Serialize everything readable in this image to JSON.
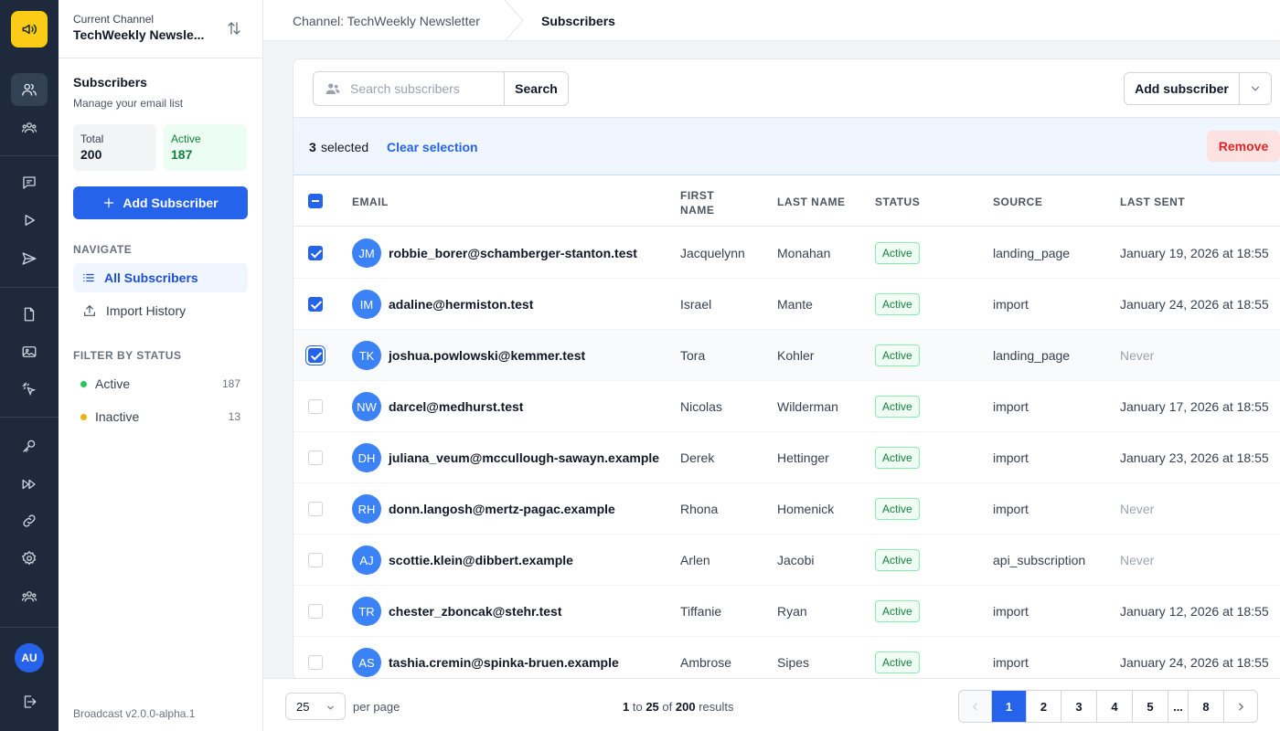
{
  "sidebar": {
    "channel_label": "Current Channel",
    "channel_name": "TechWeekly Newsle...",
    "section_title": "Subscribers",
    "section_subtitle": "Manage your email list",
    "stats": {
      "total_label": "Total",
      "total_value": "200",
      "active_label": "Active",
      "active_value": "187"
    },
    "add_button": "Add Subscriber",
    "navigate_heading": "NAVIGATE",
    "nav_items": [
      {
        "label": "All Subscribers"
      },
      {
        "label": "Import History"
      }
    ],
    "filter_heading": "FILTER BY STATUS",
    "filters": [
      {
        "label": "Active",
        "count": "187",
        "color": "#22c55e"
      },
      {
        "label": "Inactive",
        "count": "13",
        "color": "#eab308"
      }
    ],
    "version": "Broadcast v2.0.0-alpha.1"
  },
  "rail": {
    "avatar_initials": "AU"
  },
  "breadcrumb": {
    "channel": "Channel: TechWeekly Newsletter",
    "current": "Subscribers"
  },
  "toolbar": {
    "search_placeholder": "Search subscribers",
    "search_button": "Search",
    "add_subscriber": "Add subscriber"
  },
  "selection": {
    "count": "3",
    "text": "selected",
    "clear": "Clear selection",
    "remove": "Remove"
  },
  "table": {
    "headers": {
      "email": "EMAIL",
      "first_name": "FIRST NAME",
      "last_name": "LAST NAME",
      "status": "STATUS",
      "source": "SOURCE",
      "last_sent": "LAST SENT"
    },
    "rows": [
      {
        "initials": "JM",
        "email": "robbie_borer@schamberger-stanton.test",
        "first": "Jacquelynn",
        "last": "Monahan",
        "status": "Active",
        "source": "landing_page",
        "last_sent": "January 19, 2026 at 18:55",
        "checked": true
      },
      {
        "initials": "IM",
        "email": "adaline@hermiston.test",
        "first": "Israel",
        "last": "Mante",
        "status": "Active",
        "source": "import",
        "last_sent": "January 24, 2026 at 18:55",
        "checked": true
      },
      {
        "initials": "TK",
        "email": "joshua.powlowski@kemmer.test",
        "first": "Tora",
        "last": "Kohler",
        "status": "Active",
        "source": "landing_page",
        "last_sent": "Never",
        "checked": true
      },
      {
        "initials": "NW",
        "email": "darcel@medhurst.test",
        "first": "Nicolas",
        "last": "Wilderman",
        "status": "Active",
        "source": "import",
        "last_sent": "January 17, 2026 at 18:55",
        "checked": false
      },
      {
        "initials": "DH",
        "email": "juliana_veum@mccullough-sawayn.example",
        "first": "Derek",
        "last": "Hettinger",
        "status": "Active",
        "source": "import",
        "last_sent": "January 23, 2026 at 18:55",
        "checked": false
      },
      {
        "initials": "RH",
        "email": "donn.langosh@mertz-pagac.example",
        "first": "Rhona",
        "last": "Homenick",
        "status": "Active",
        "source": "import",
        "last_sent": "Never",
        "checked": false
      },
      {
        "initials": "AJ",
        "email": "scottie.klein@dibbert.example",
        "first": "Arlen",
        "last": "Jacobi",
        "status": "Active",
        "source": "api_subscription",
        "last_sent": "Never",
        "checked": false
      },
      {
        "initials": "TR",
        "email": "chester_zboncak@stehr.test",
        "first": "Tiffanie",
        "last": "Ryan",
        "status": "Active",
        "source": "import",
        "last_sent": "January 12, 2026 at 18:55",
        "checked": false
      },
      {
        "initials": "AS",
        "email": "tashia.cremin@spinka-bruen.example",
        "first": "Ambrose",
        "last": "Sipes",
        "status": "Active",
        "source": "import",
        "last_sent": "January 24, 2026 at 18:55",
        "checked": false
      }
    ]
  },
  "footer": {
    "per_page": "25",
    "per_page_label": "per page",
    "results": {
      "from": "1",
      "to_word": "to",
      "to": "25",
      "of_word": "of",
      "total": "200",
      "suffix": "results"
    },
    "pages": [
      "1",
      "2",
      "3",
      "4",
      "5",
      "...",
      "8"
    ],
    "current_page": "1"
  }
}
